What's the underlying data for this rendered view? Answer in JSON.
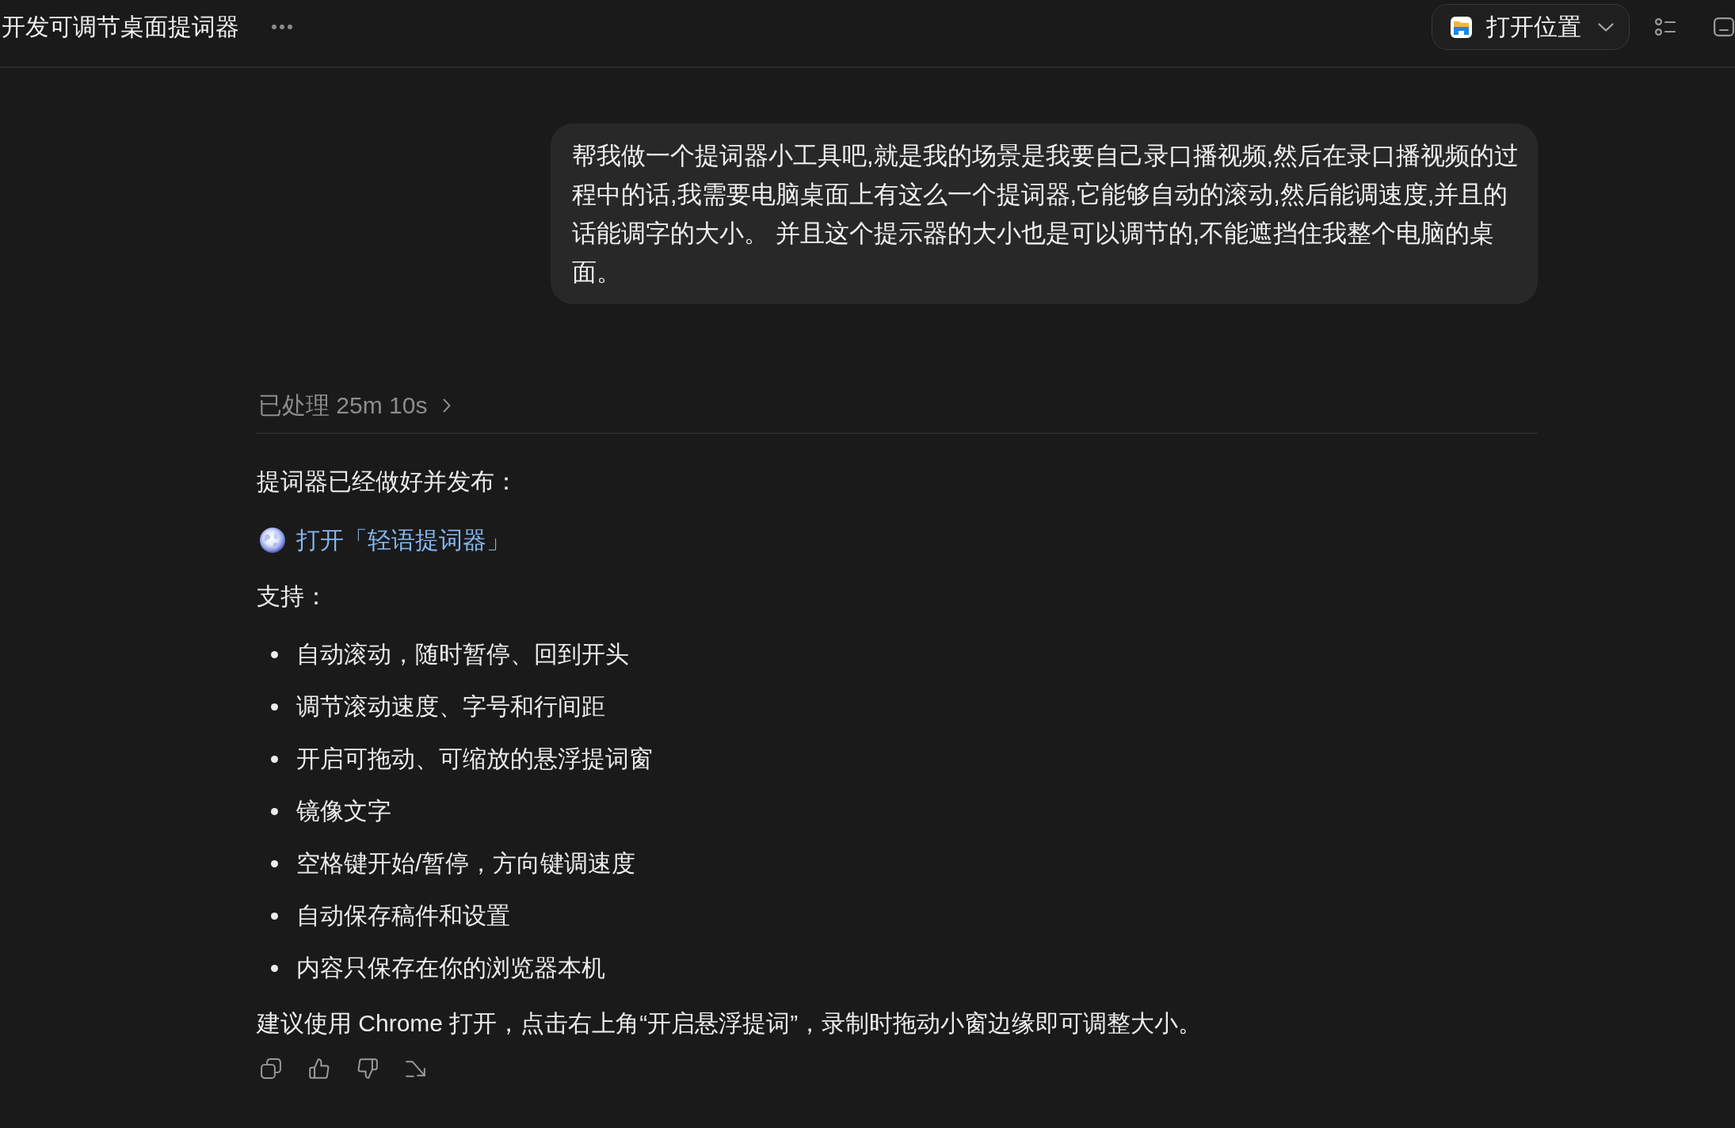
{
  "header": {
    "title": "开发可调节桌面提词器",
    "open_location_button": {
      "label": "打开位置"
    }
  },
  "user_message": {
    "text": "帮我做一个提词器小工具吧,就是我的场景是我要自己录口播视频,然后在录口播视频的过程中的话,我需要电脑桌面上有这么一个提词器,它能够自动的滚动,然后能调速度,并且的话能调字的大小。 并且这个提示器的大小也是可以调节的,不能遮挡住我整个电脑的桌面。"
  },
  "assistant_message": {
    "processing": {
      "label": "已处理 25m 10s",
      "expanded": false
    },
    "intro": "提词器已经做好并发布：",
    "link": {
      "label": "打开「轻语提词器」"
    },
    "features_heading": "支持：",
    "features": [
      "自动滚动，随时暂停、回到开头",
      "调节滚动速度、字号和行间距",
      "开启可拖动、可缩放的悬浮提词窗",
      "镜像文字",
      "空格键开始/暂停，方向键调速度",
      "自动保存稿件和设置",
      "内容只保存在你的浏览器本机"
    ],
    "note": "建议使用 Chrome 打开，点击右上角“开启悬浮提词”，录制时拖动小窗边缘即可调整大小。"
  }
}
